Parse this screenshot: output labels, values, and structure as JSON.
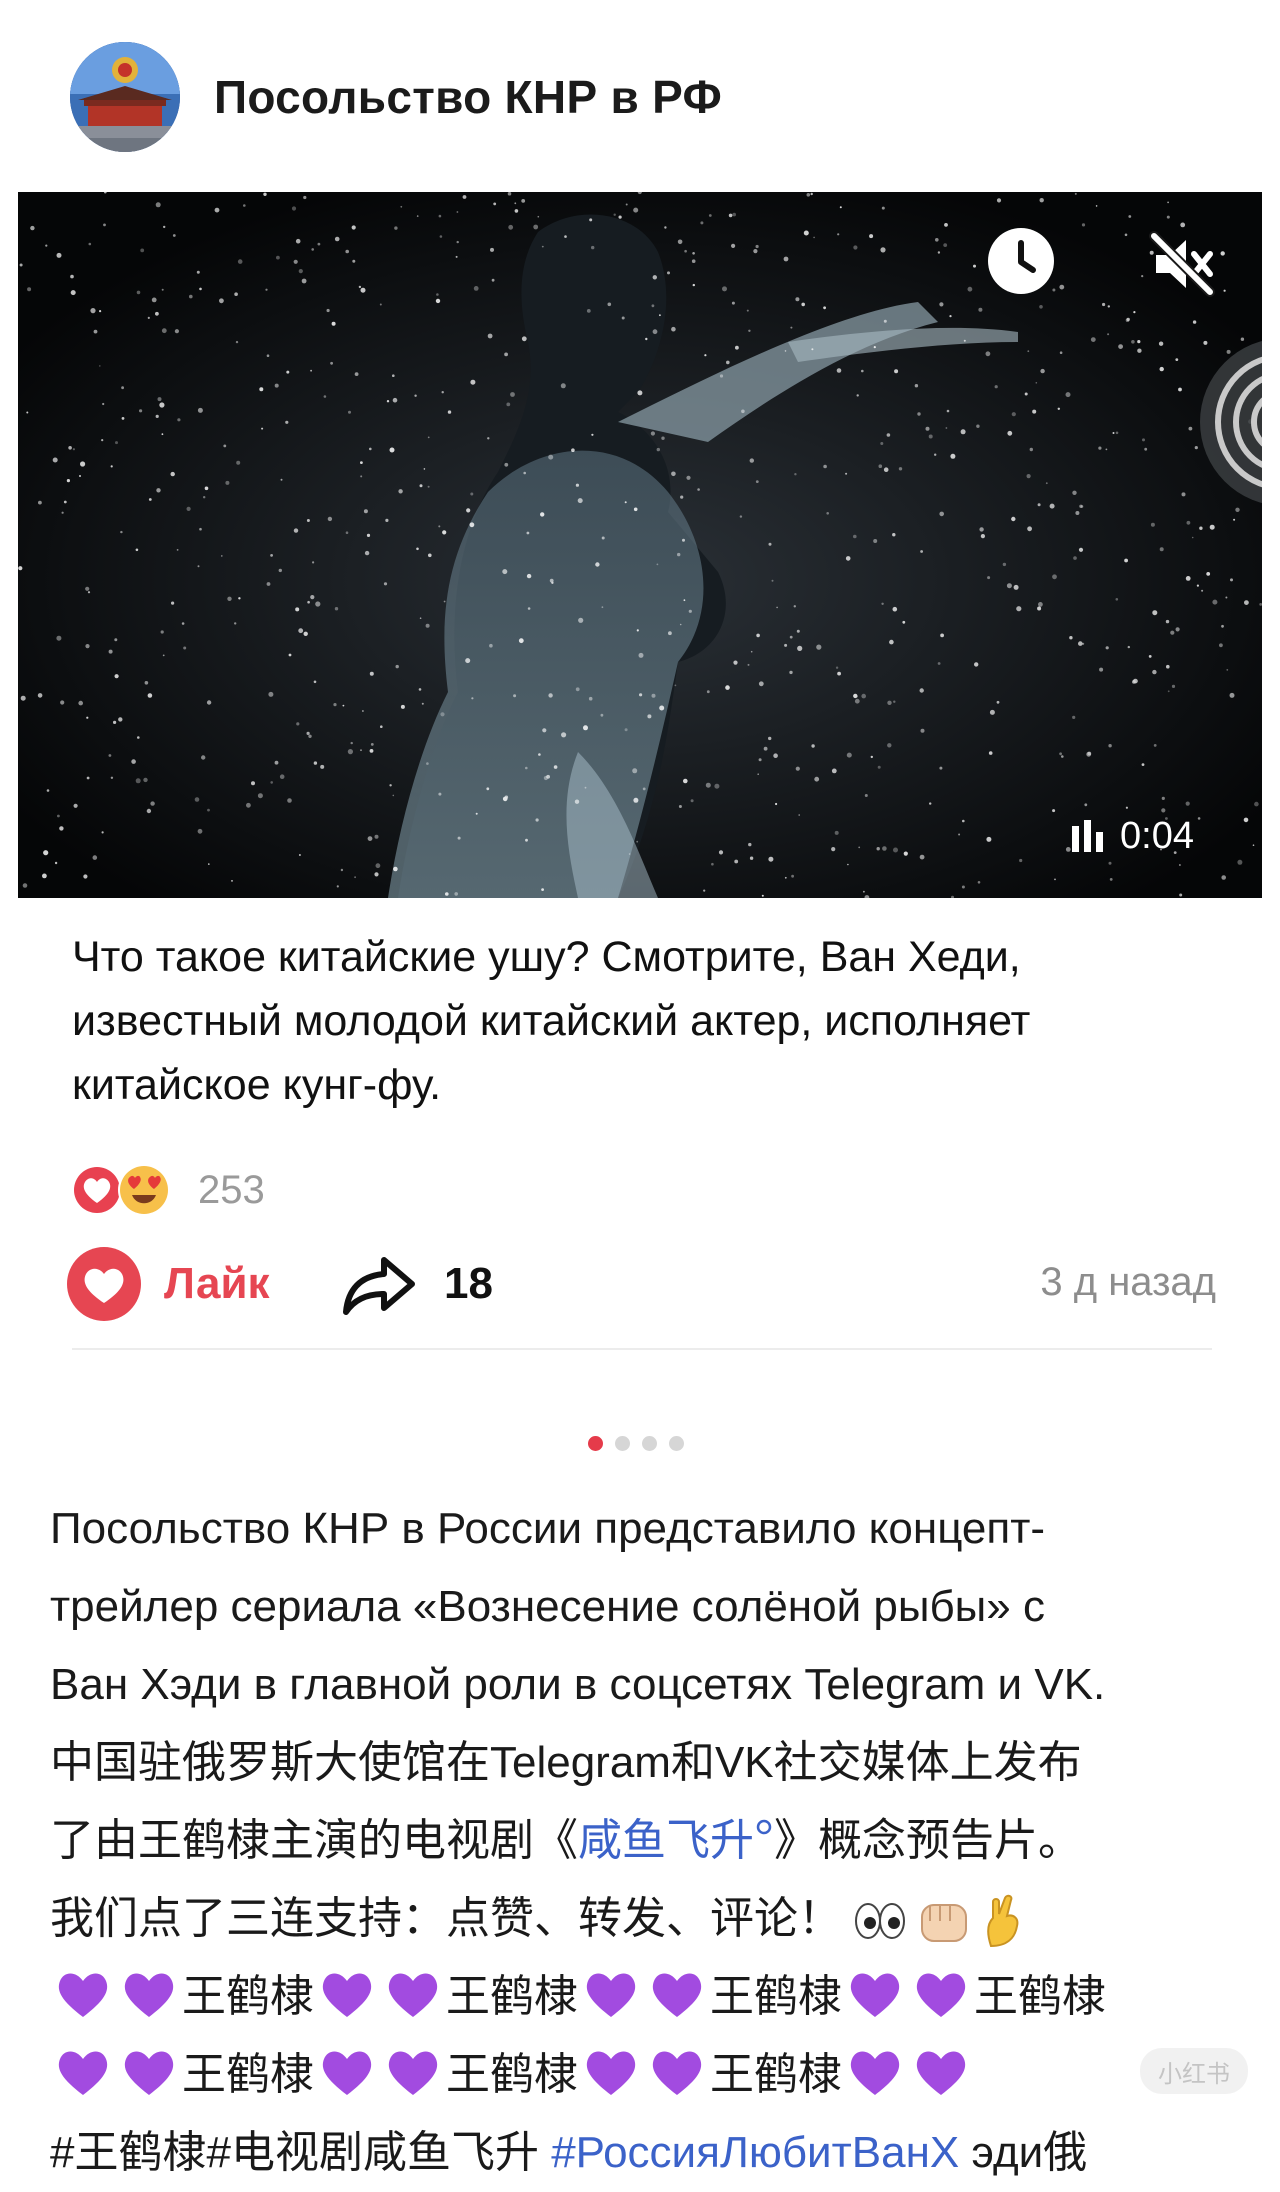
{
  "header": {
    "channel_name": "Посольство КНР в РФ"
  },
  "video": {
    "duration": "0:04"
  },
  "post": {
    "text": "Что такое китайские ушу? Смотрите, Ван Хеди, известный молодой китайский актер, исполняет китайское кунг-фу.",
    "reaction_count": "253",
    "like_label": "Лайк",
    "share_count": "18",
    "timestamp": "3 д назад"
  },
  "pager": {
    "total": 4,
    "active": 1
  },
  "description": {
    "line1": "Посольство КНР в России представило концепт-",
    "line2": "трейлер сериала «Вознесение солёной рыбы» с",
    "line3": "Ван Хэди в главной роли в соцсетях Telegram и VK.",
    "line4": "中国驻俄罗斯大使馆在Telegram和VK社交媒体上发布",
    "line5_pre": "了由王鹤棣主演的电视剧《",
    "line5_link": "咸鱼飞升",
    "line5_post": "》概念预告片。",
    "line6": "我们点了三连支持：点赞、转发、评论！",
    "name": "王鹤棣",
    "hashtag1": "#王鹤棣",
    "hashtag2": "#电视剧咸鱼飞升",
    "hashtag3": "#РоссияЛюбитВанХ",
    "tail": "эди俄"
  },
  "colors": {
    "like_red": "#e64652",
    "link_blue": "#3b62c9",
    "heart_purple": "#a24be0",
    "pager_active": "#e53b4a"
  },
  "icons": [
    "clock-icon",
    "mute-icon",
    "bars-icon",
    "heart-icon",
    "heart-eyes-icon",
    "share-icon",
    "eyes-icon",
    "fist-icon",
    "ok-hand-icon",
    "purple-heart-icon"
  ],
  "watermark": "小红书"
}
